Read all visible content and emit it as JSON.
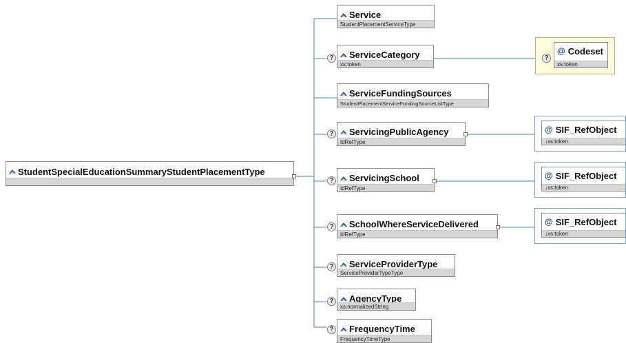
{
  "root": {
    "name": "StudentSpecialEducationSummaryStudentPlacementType",
    "icon": "complex-type-icon"
  },
  "children": [
    {
      "name": "Service",
      "type": "StudentPlacementServiceType",
      "optional": false,
      "icon": "element-icon"
    },
    {
      "name": "ServiceCategory",
      "type": "xs:token",
      "optional": true,
      "icon": "element-icon"
    },
    {
      "name": "ServiceFundingSources",
      "type": "StudentPlacementServiceFundingSourceListType",
      "optional": false,
      "icon": "element-icon"
    },
    {
      "name": "ServicingPublicAgency",
      "type": "IdRefType",
      "optional": true,
      "icon": "element-icon"
    },
    {
      "name": "ServicingSchool",
      "type": "IdRefType",
      "optional": true,
      "icon": "element-icon"
    },
    {
      "name": "SchoolWhereServiceDelivered",
      "type": "IdRefType",
      "optional": true,
      "icon": "element-icon"
    },
    {
      "name": "ServiceProviderType",
      "type": "ServiceProviderTypeType",
      "optional": true,
      "icon": "element-icon"
    },
    {
      "name": "AgencyType",
      "type": "xs:normalizedString",
      "optional": true,
      "icon": "element-icon"
    },
    {
      "name": "FrequencyTime",
      "type": "FrequencyTimeType",
      "optional": true,
      "icon": "element-icon"
    }
  ],
  "attributes": [
    {
      "name": "Codeset",
      "type": "xs:token",
      "optional": true,
      "icon": "attribute-at-icon"
    },
    {
      "name": "SIF_RefObject",
      "type": "xs:token",
      "optional": false,
      "icon": "attribute-at-icon"
    },
    {
      "name": "SIF_RefObject",
      "type": "xs:token",
      "optional": false,
      "icon": "attribute-at-icon"
    },
    {
      "name": "SIF_RefObject",
      "type": "xs:token",
      "optional": false,
      "icon": "attribute-at-icon"
    }
  ],
  "colors": {
    "connector": "#4a7fa8",
    "type_bar": "#d6d6d6",
    "border": "#8a8a8a",
    "icon_blue": "#1f5fa0",
    "icon_yellow": "#f0c419",
    "attr_frame": "#7aa0c0",
    "attr_frame_fill_yellow": "#fefbdc"
  },
  "glyphs": {
    "question": "?",
    "at": "@",
    "attr_type_prefix": "↓"
  }
}
